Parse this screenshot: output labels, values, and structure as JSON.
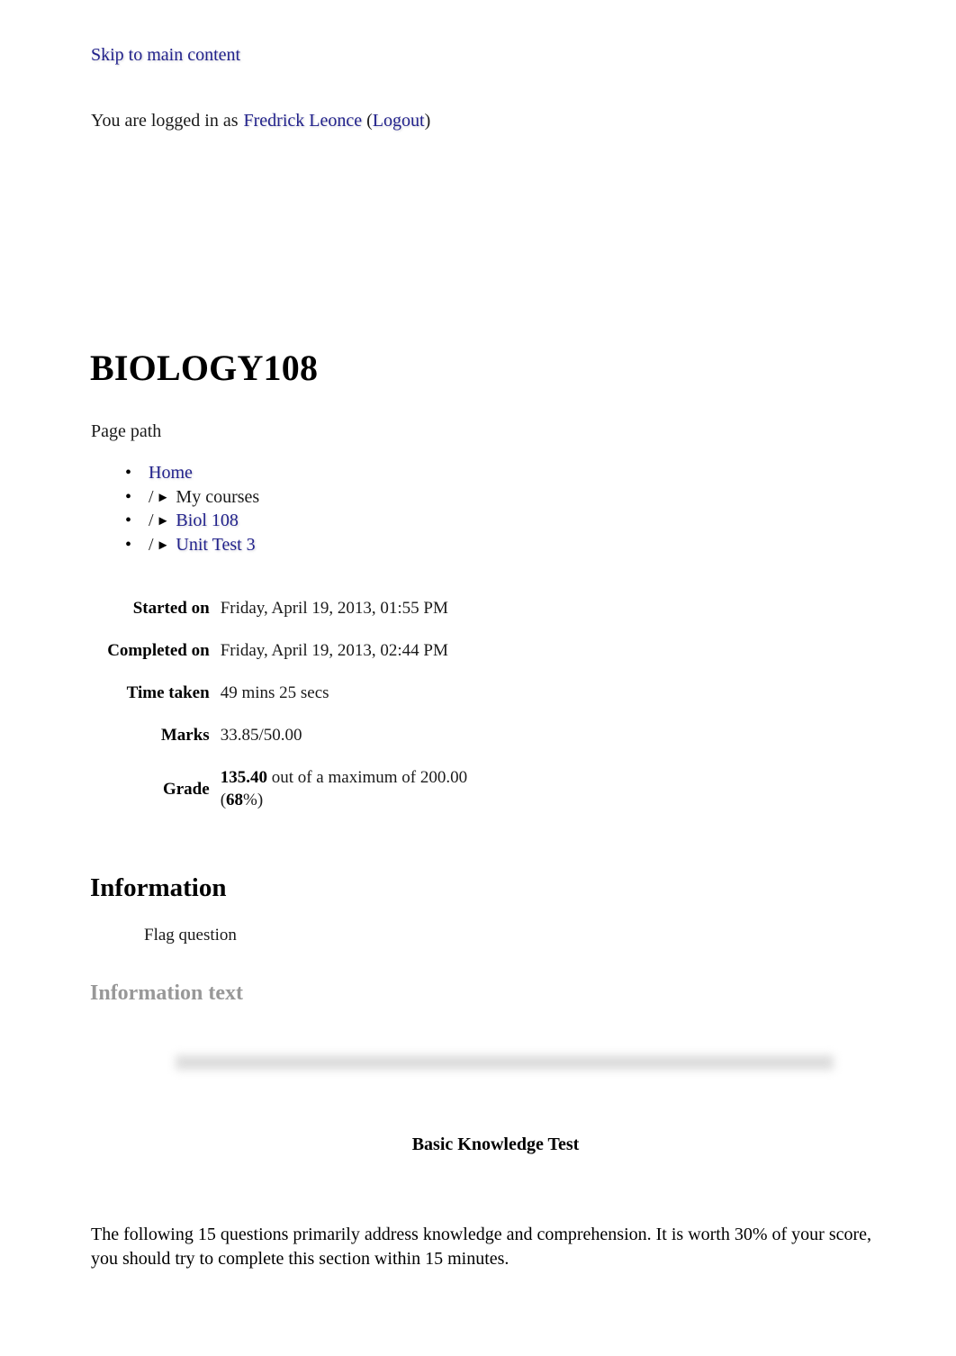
{
  "accessibility": {
    "skip_link_label": "Skip to main content"
  },
  "user_bar": {
    "prefix": "You are logged in as ",
    "user_name": "Fredrick Leonce",
    "open_paren": " (",
    "logout_label": "Logout",
    "close_paren": ")"
  },
  "header": {
    "site_title": "BIOLOGY108"
  },
  "breadcrumb": {
    "label": "Page path",
    "bullet_glyph": "•",
    "separator": "/",
    "arrow_glyph": "►",
    "items": [
      {
        "label": "Home",
        "is_link": true,
        "has_separator": false
      },
      {
        "label": "My courses",
        "is_link": false,
        "has_separator": true
      },
      {
        "label": "Biol 108",
        "is_link": true,
        "has_separator": true
      },
      {
        "label": "Unit Test 3",
        "is_link": true,
        "has_separator": true
      }
    ]
  },
  "summary": {
    "rows": [
      {
        "label": "Started on",
        "value": "Friday, April 19, 2013, 01:55 PM"
      },
      {
        "label": "Completed on",
        "value": "Friday, April 19, 2013, 02:44 PM"
      },
      {
        "label": "Time taken",
        "value": "49 mins 25 secs"
      },
      {
        "label": "Marks",
        "value": "33.85/50.00"
      }
    ],
    "grade": {
      "label": "Grade",
      "score": "135.40",
      "middle_text": " out of a maximum of 200.00 (",
      "percent": "68",
      "suffix": "%)"
    }
  },
  "question": {
    "heading": "Information",
    "flag_label": "Flag question",
    "info_text_heading": "Information text",
    "test_title": "Basic Knowledge Test",
    "instructions": "The following 15 questions primarily address knowledge and comprehension. It is worth 30% of your score, you should try to complete this section within 15 minutes."
  },
  "colors": {
    "link": "#22228c",
    "muted_heading": "#989898",
    "divider_bar": "#dadada",
    "text": "#000000",
    "background": "#ffffff"
  }
}
